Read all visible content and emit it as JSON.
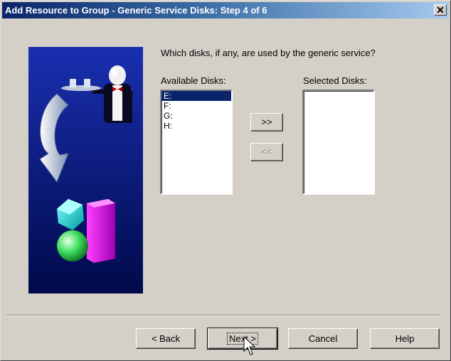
{
  "window": {
    "title": "Add Resource to Group - Generic Service Disks:  Step 4 of 6",
    "close_glyph": "✕"
  },
  "wizard_image": {
    "description_icon": "wizard-butler-arrow-shapes-icon"
  },
  "question": "Which disks, if any, are used by the generic service?",
  "available": {
    "label": "Available Disks:",
    "items": [
      "E:",
      "F:",
      "G:",
      "H:"
    ],
    "selected_index": 0
  },
  "selected": {
    "label": "Selected Disks:",
    "items": []
  },
  "move_buttons": {
    "add": ">>",
    "remove": "<<"
  },
  "footer": {
    "back": "< Back",
    "next": "Next >",
    "cancel": "Cancel",
    "help": "Help"
  },
  "colors": {
    "title_start": "#0a246a",
    "title_end": "#a6caf0",
    "face": "#d4d0c8",
    "highlight": "#0a246a"
  }
}
